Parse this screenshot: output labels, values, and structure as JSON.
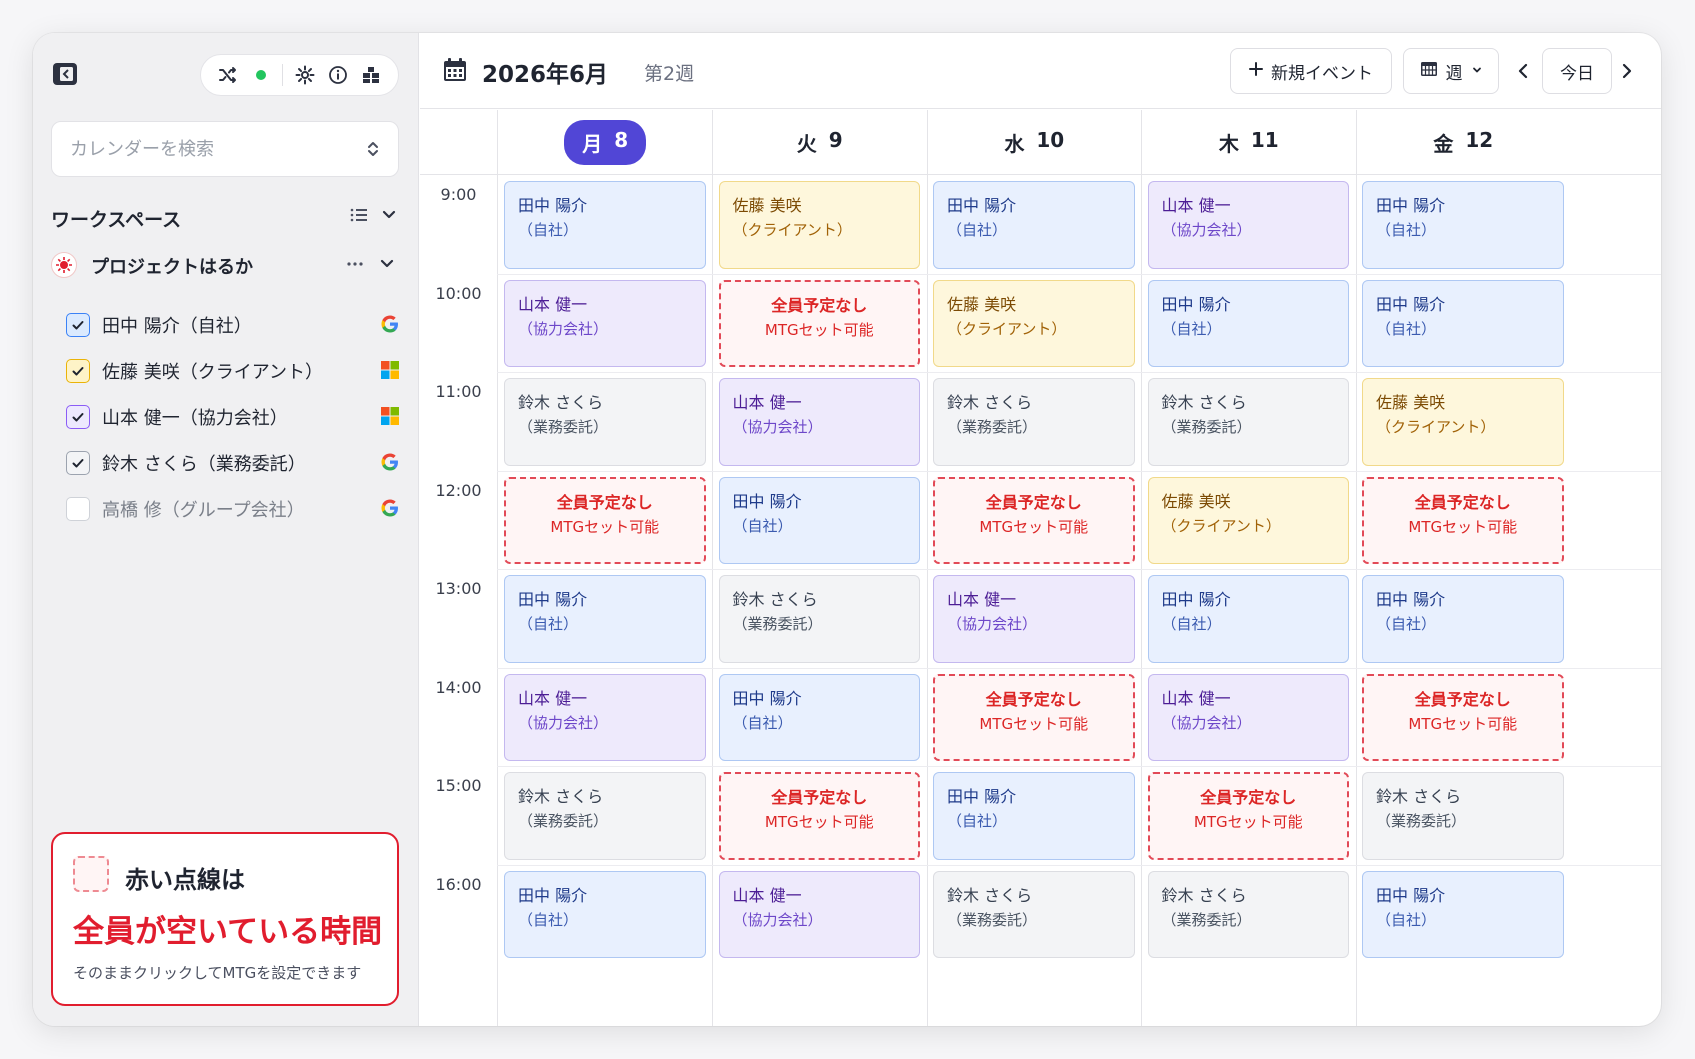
{
  "colors": {
    "accent": "#5146d6",
    "free_border": "#e24a57",
    "free_text": "#dc2626",
    "blue": "#e8f0fe",
    "yellow": "#fef7dc",
    "purple": "#eeeafc",
    "gray": "#f3f4f6"
  },
  "sidebar": {
    "search_placeholder": "カレンダーを検索",
    "workspace_title": "ワークスペース",
    "project_name": "プロジェクトはるか",
    "calendars": [
      {
        "label": "田中 陽介（自社）",
        "checked": true,
        "color": "#3b82f6",
        "provider": "google-icon"
      },
      {
        "label": "佐藤 美咲（クライアント）",
        "checked": true,
        "color": "#eab308",
        "provider": "microsoft-icon"
      },
      {
        "label": "山本 健一（協力会社）",
        "checked": true,
        "color": "#8b5cf6",
        "provider": "microsoft-icon"
      },
      {
        "label": "鈴木 さくら（業務委託）",
        "checked": true,
        "color": "#9ca3af",
        "provider": "google-icon"
      },
      {
        "label": "高橋 修（グループ会社）",
        "checked": false,
        "color": "#d1d5db",
        "provider": "google-icon"
      }
    ],
    "legend": {
      "line1": "赤い点線は",
      "line2": "全員が空いている時間",
      "line3": "そのままクリックしてMTGを設定できます"
    }
  },
  "header": {
    "title": "2026年6月",
    "week": "第2週",
    "new_event": "新規イベント",
    "view": "週",
    "today": "今日"
  },
  "days": [
    {
      "dow": "月",
      "date": "8",
      "today": true
    },
    {
      "dow": "火",
      "date": "9",
      "today": false
    },
    {
      "dow": "水",
      "date": "10",
      "today": false
    },
    {
      "dow": "木",
      "date": "11",
      "today": false
    },
    {
      "dow": "金",
      "date": "12",
      "today": false
    }
  ],
  "times": [
    "9:00",
    "10:00",
    "11:00",
    "12:00",
    "13:00",
    "14:00",
    "15:00",
    "16:00"
  ],
  "free_slot": {
    "title": "全員予定なし",
    "sub": "MTGセット可能"
  },
  "events": [
    [
      {
        "type": "blue",
        "name": "田中 陽介",
        "org": "（自社）"
      },
      {
        "type": "purple",
        "name": "山本 健一",
        "org": "（協力会社）"
      },
      {
        "type": "gray",
        "name": "鈴木 さくら",
        "org": "（業務委託）"
      },
      {
        "type": "free"
      },
      {
        "type": "blue",
        "name": "田中 陽介",
        "org": "（自社）"
      },
      {
        "type": "purple",
        "name": "山本 健一",
        "org": "（協力会社）"
      },
      {
        "type": "gray",
        "name": "鈴木 さくら",
        "org": "（業務委託）"
      },
      {
        "type": "blue",
        "name": "田中 陽介",
        "org": "（自社）"
      }
    ],
    [
      {
        "type": "yellow",
        "name": "佐藤 美咲",
        "org": "（クライアント）"
      },
      {
        "type": "free"
      },
      {
        "type": "purple",
        "name": "山本 健一",
        "org": "（協力会社）"
      },
      {
        "type": "blue",
        "name": "田中 陽介",
        "org": "（自社）"
      },
      {
        "type": "gray",
        "name": "鈴木 さくら",
        "org": "（業務委託）"
      },
      {
        "type": "blue",
        "name": "田中 陽介",
        "org": "（自社）"
      },
      {
        "type": "free"
      },
      {
        "type": "purple",
        "name": "山本 健一",
        "org": "（協力会社）"
      }
    ],
    [
      {
        "type": "blue",
        "name": "田中 陽介",
        "org": "（自社）"
      },
      {
        "type": "yellow",
        "name": "佐藤 美咲",
        "org": "（クライアント）"
      },
      {
        "type": "gray",
        "name": "鈴木 さくら",
        "org": "（業務委託）"
      },
      {
        "type": "free"
      },
      {
        "type": "purple",
        "name": "山本 健一",
        "org": "（協力会社）"
      },
      {
        "type": "free"
      },
      {
        "type": "blue",
        "name": "田中 陽介",
        "org": "（自社）"
      },
      {
        "type": "gray",
        "name": "鈴木 さくら",
        "org": "（業務委託）"
      }
    ],
    [
      {
        "type": "purple",
        "name": "山本 健一",
        "org": "（協力会社）"
      },
      {
        "type": "blue",
        "name": "田中 陽介",
        "org": "（自社）"
      },
      {
        "type": "gray",
        "name": "鈴木 さくら",
        "org": "（業務委託）"
      },
      {
        "type": "yellow",
        "name": "佐藤 美咲",
        "org": "（クライアント）"
      },
      {
        "type": "blue",
        "name": "田中 陽介",
        "org": "（自社）"
      },
      {
        "type": "purple",
        "name": "山本 健一",
        "org": "（協力会社）"
      },
      {
        "type": "free"
      },
      {
        "type": "gray",
        "name": "鈴木 さくら",
        "org": "（業務委託）"
      }
    ],
    [
      {
        "type": "blue",
        "name": "田中 陽介",
        "org": "（自社）"
      },
      {
        "type": "blue",
        "name": "田中 陽介",
        "org": "（自社）"
      },
      {
        "type": "yellow",
        "name": "佐藤 美咲",
        "org": "（クライアント）"
      },
      {
        "type": "free"
      },
      {
        "type": "blue",
        "name": "田中 陽介",
        "org": "（自社）"
      },
      {
        "type": "free"
      },
      {
        "type": "gray",
        "name": "鈴木 さくら",
        "org": "（業務委託）"
      },
      {
        "type": "blue",
        "name": "田中 陽介",
        "org": "（自社）"
      }
    ]
  ]
}
